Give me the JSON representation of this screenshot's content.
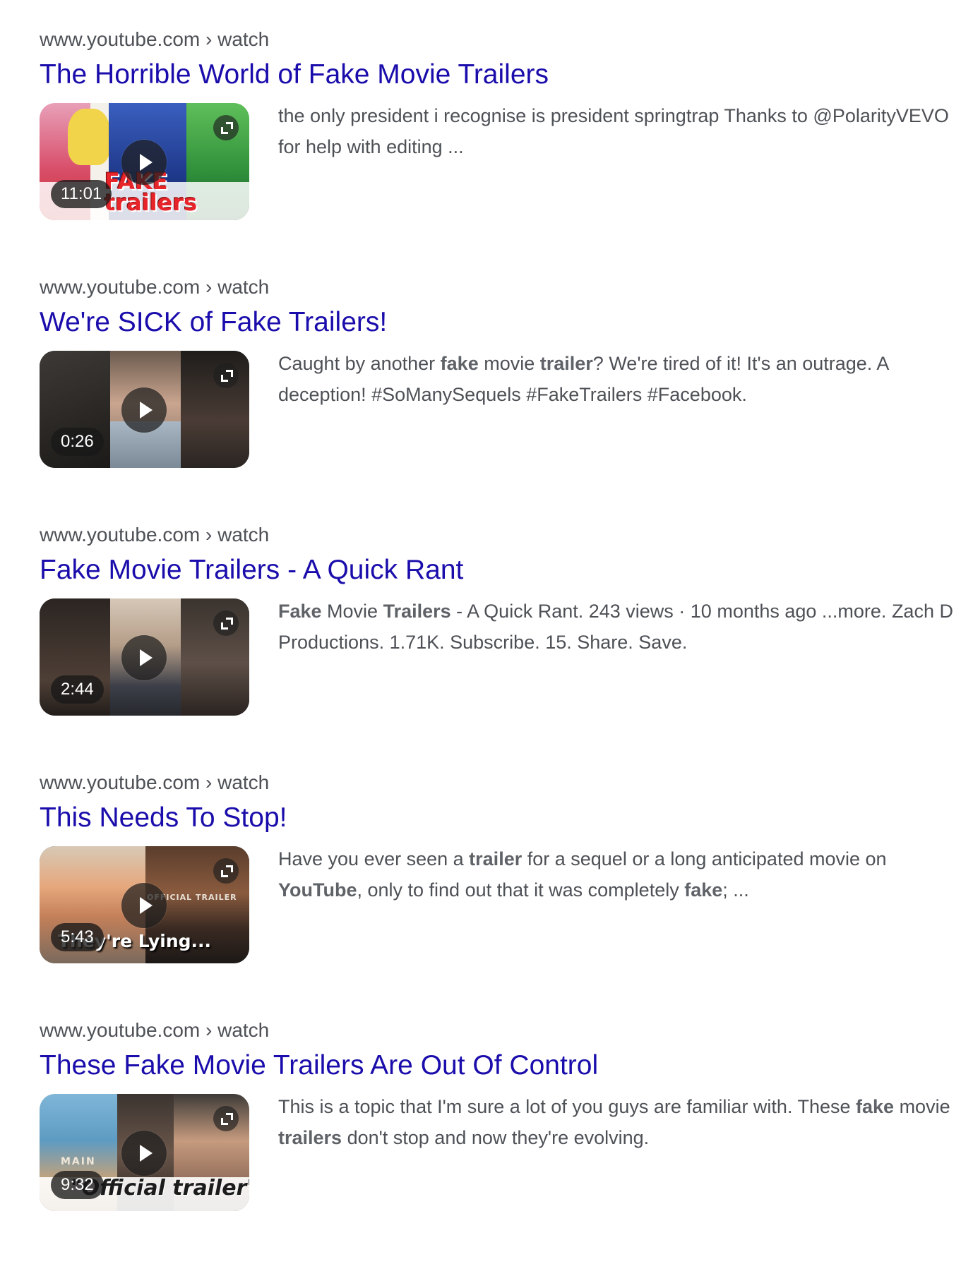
{
  "results": [
    {
      "cite": "www.youtube.com › watch",
      "title": "The Horrible World of Fake Movie Trailers",
      "duration": "11:01",
      "thumbnail_caption": "FAKE trailers",
      "snippet": [
        {
          "text": "the only president i recognise is president springtrap Thanks to @PolarityVEVO for help with editing ...",
          "bold": false
        }
      ]
    },
    {
      "cite": "www.youtube.com › watch",
      "title": "We're SICK of Fake Trailers!",
      "duration": "0:26",
      "snippet": [
        {
          "text": "Caught by another ",
          "bold": false
        },
        {
          "text": "fake",
          "bold": true
        },
        {
          "text": " movie ",
          "bold": false
        },
        {
          "text": "trailer",
          "bold": true
        },
        {
          "text": "? We're tired of it! It's an outrage. A deception! #SoManySequels #FakeTrailers #Facebook.",
          "bold": false
        }
      ]
    },
    {
      "cite": "www.youtube.com › watch",
      "title": "Fake Movie Trailers - A Quick Rant",
      "duration": "2:44",
      "snippet": [
        {
          "text": "Fake",
          "bold": true
        },
        {
          "text": " Movie ",
          "bold": false
        },
        {
          "text": "Trailers",
          "bold": true
        },
        {
          "text": " - A Quick Rant. 243 views · 10 months ago ...more. Zach D Productions. 1.71K. Subscribe. 15. Share. Save.",
          "bold": false
        }
      ]
    },
    {
      "cite": "www.youtube.com › watch",
      "title": "This Needs To Stop!",
      "duration": "5:43",
      "thumbnail_caption": "They're Lying...",
      "thumbnail_caption_2": "OFFICIAL TRAILER",
      "snippet": [
        {
          "text": "Have you ever seen a ",
          "bold": false
        },
        {
          "text": "trailer",
          "bold": true
        },
        {
          "text": " for a sequel or a long anticipated movie on ",
          "bold": false
        },
        {
          "text": "YouTube",
          "bold": true
        },
        {
          "text": ", only to find out that it was completely ",
          "bold": false
        },
        {
          "text": "fake",
          "bold": true
        },
        {
          "text": "; ...",
          "bold": false
        }
      ]
    },
    {
      "cite": "www.youtube.com › watch",
      "title": "These Fake Movie Trailers Are Out Of Control",
      "duration": "9:32",
      "thumbnail_caption": "\"Official trailer\"",
      "thumbnail_caption_2": "MAIN",
      "snippet": [
        {
          "text": "This is a topic that I'm sure a lot of you guys are familiar with. These ",
          "bold": false
        },
        {
          "text": "fake",
          "bold": true
        },
        {
          "text": " movie ",
          "bold": false
        },
        {
          "text": "trailers",
          "bold": true
        },
        {
          "text": " don't stop and now they're evolving.",
          "bold": false
        }
      ]
    }
  ],
  "colors": {
    "title_link": "#1a0dab",
    "cite_text": "#4d5156",
    "snippet_text": "#4d5156",
    "snippet_bold": "#5f6368"
  },
  "icons": {
    "play": "play-icon",
    "expand": "expand-icon"
  }
}
